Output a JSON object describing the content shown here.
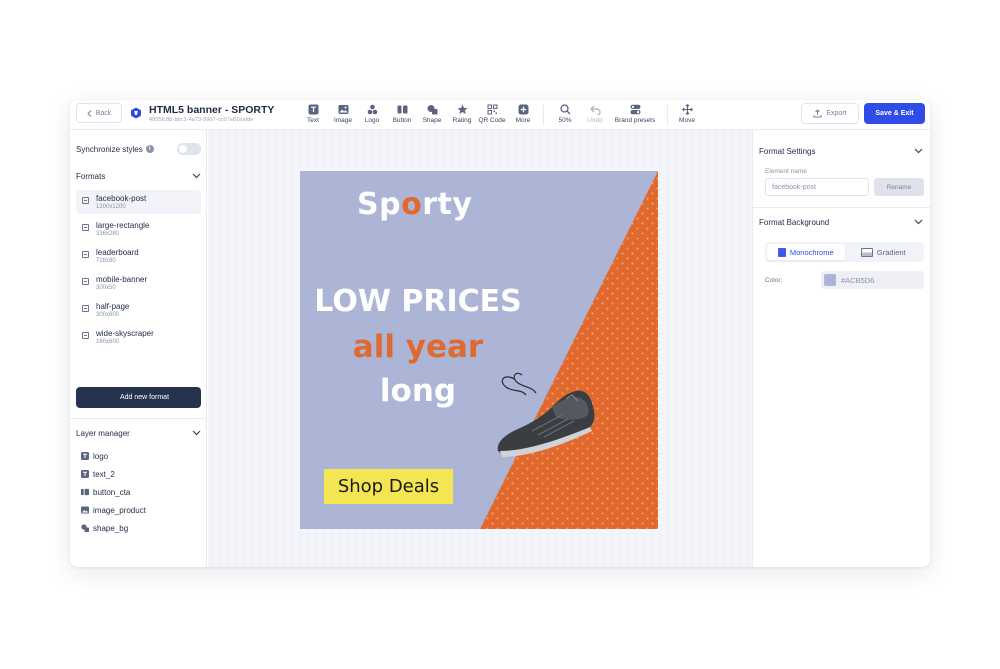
{
  "header": {
    "back_label": "Back",
    "project_title": "HTML5 banner - SPORTY",
    "project_id": "4805fc8b-bbc1-4a73-9907-cc07e81bafde",
    "tools": [
      {
        "label": "Text",
        "icon": "text-icon"
      },
      {
        "label": "Image",
        "icon": "image-icon"
      },
      {
        "label": "Logo",
        "icon": "logo-icon"
      },
      {
        "label": "Button",
        "icon": "button-icon"
      },
      {
        "label": "Shape",
        "icon": "shape-icon"
      },
      {
        "label": "Rating",
        "icon": "star-icon"
      },
      {
        "label": "QR Code",
        "icon": "qr-code-icon"
      },
      {
        "label": "More",
        "icon": "plus-icon"
      },
      {
        "label": "50%",
        "icon": "zoom-icon"
      },
      {
        "label": "Undo",
        "icon": "undo-icon"
      },
      {
        "label": "Brand presets",
        "icon": "brand-presets-icon"
      },
      {
        "label": "Move",
        "icon": "move-icon"
      }
    ],
    "export_label": "Export",
    "save_label": "Save & Exit"
  },
  "left_panel": {
    "sync_label": "Synchronize styles",
    "sync_enabled": false,
    "formats_title": "Formats",
    "formats": [
      {
        "name": "facebook-post",
        "size": "1200x1200",
        "selected": true
      },
      {
        "name": "large-rectangle",
        "size": "336x280",
        "selected": false
      },
      {
        "name": "leaderboard",
        "size": "728x90",
        "selected": false
      },
      {
        "name": "mobile-banner",
        "size": "300x50",
        "selected": false
      },
      {
        "name": "half-page",
        "size": "300x600",
        "selected": false
      },
      {
        "name": "wide-skyscraper",
        "size": "160x600",
        "selected": false
      }
    ],
    "add_format_label": "Add new format",
    "layers_title": "Layer manager",
    "layers": [
      {
        "name": "logo",
        "icon": "text-layer-icon"
      },
      {
        "name": "text_2",
        "icon": "text-layer-icon"
      },
      {
        "name": "button_cta",
        "icon": "button-layer-icon"
      },
      {
        "name": "image_product",
        "icon": "image-layer-icon"
      },
      {
        "name": "shape_bg",
        "icon": "shape-layer-icon"
      }
    ]
  },
  "banner": {
    "logo_pre": "Sp",
    "logo_o": "o",
    "logo_post": "rty",
    "line1": "LOW PRICES",
    "line2": "all year",
    "line3": "long",
    "cta": "Shop Deals",
    "colors": {
      "background": "#ACB5D6",
      "accent": "#E2692E",
      "cta": "#F5E552"
    }
  },
  "right_panel": {
    "format_settings_title": "Format Settings",
    "element_name_label": "Element name",
    "element_name_placeholder": "facebook-post",
    "rename_label": "Rename",
    "format_background_title": "Format Background",
    "mode_monochrome": "Monochrome",
    "mode_gradient": "Gradient",
    "active_mode": "Monochrome",
    "color_label": "Color:",
    "color_value": "#ACB5D6"
  },
  "theme": {
    "primary": "#2F4DE6",
    "dark_button": "#27324F"
  }
}
